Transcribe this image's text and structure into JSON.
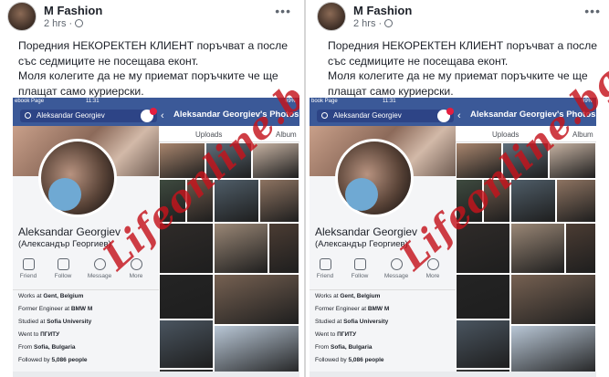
{
  "post": {
    "page_name": "M Fashion",
    "time": "2 hrs",
    "more": "•••",
    "text_lines": [
      "Поредния НЕКОРЕКТЕН КЛИЕНТ  поръчват а после",
      "със седмиците не посещава еконт.",
      "Моля колегите да не му приемат поръчките че ще",
      "плащат само куриерски."
    ]
  },
  "phone": {
    "status_left": "ebook Page",
    "status_left_right_panel": "book Page",
    "time": "11:31",
    "battery": "69%",
    "search_value": "Aleksandar Georgiev",
    "photos_title": "Aleksandar Georgiev's Photos",
    "tabs": [
      "Uploads",
      "Album"
    ],
    "profile_name": "Aleksandar Georgiev",
    "profile_name_cyr": "(Александър Георгиев)",
    "actions": [
      "Friend",
      "Follow",
      "Message",
      "More"
    ],
    "info": [
      {
        "prefix": "Works at ",
        "bold": "Gent, Belgium"
      },
      {
        "prefix": "Former Engineer at ",
        "bold": "BMW M"
      },
      {
        "prefix": "Studied at ",
        "bold": "Sofia University"
      },
      {
        "prefix": "Went to ",
        "bold": "ПГИТУ"
      },
      {
        "prefix": "From ",
        "bold": "Sofia, Bulgaria"
      },
      {
        "prefix": "Followed by ",
        "bold": "5,086 people"
      }
    ]
  },
  "watermark": "Lifeonline.bg",
  "colors": {
    "facebook_blue": "#3b5998",
    "watermark_red": "#c4141c",
    "text": "#1d2129",
    "muted": "#606770"
  }
}
